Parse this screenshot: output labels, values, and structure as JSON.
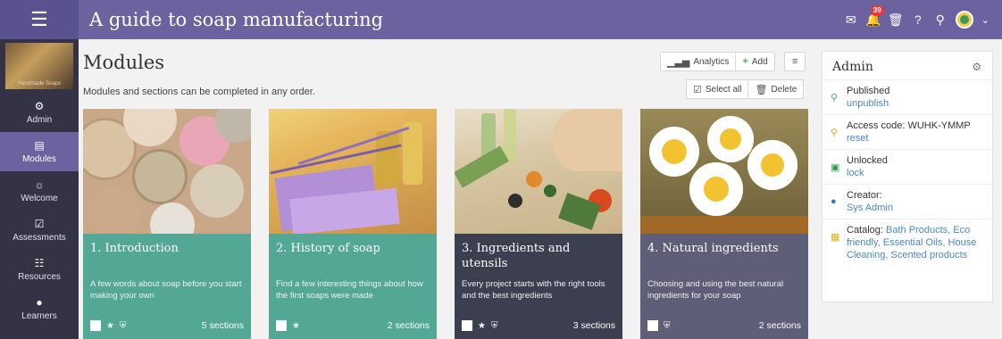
{
  "header": {
    "title": "A guide to soap manufacturing",
    "notification_count": "39"
  },
  "sidebar": {
    "logo_text": "Handmade Soaps",
    "items": [
      {
        "label": "Admin"
      },
      {
        "label": "Modules"
      },
      {
        "label": "Welcome"
      },
      {
        "label": "Assessments"
      },
      {
        "label": "Resources"
      },
      {
        "label": "Learners"
      }
    ]
  },
  "main": {
    "title": "Modules",
    "subtitle": "Modules and sections can be completed in any order.",
    "analytics_label": "Analytics",
    "add_label": "Add",
    "select_all_label": "Select all",
    "delete_label": "Delete"
  },
  "modules": [
    {
      "title": "1. Introduction",
      "desc": "A few words about soap before you start making your own",
      "sections": "5 sections"
    },
    {
      "title": "2. History of soap",
      "desc": "Find a few interesting things about how the first soaps were made",
      "sections": "2 sections"
    },
    {
      "title": "3. Ingredients and utensils",
      "desc": "Every project starts with the right tools and the best ingredients",
      "sections": "3 sections"
    },
    {
      "title": "4. Natural ingredients",
      "desc": "Choosing and using the best natural ingredients for your soap",
      "sections": "2 sections"
    }
  ],
  "admin_panel": {
    "title": "Admin",
    "published_label": "Published",
    "unpublish_link": "unpublish",
    "access_code_label": "Access code: WUHK-YMMP",
    "reset_link": "reset",
    "unlocked_label": "Unlocked",
    "lock_link": "lock",
    "creator_label": "Creator:",
    "creator_name": "Sys Admin",
    "catalog_label": "Catalog:",
    "catalog_items": [
      "Bath Products,",
      "Eco friendly,",
      "Essential Oils,",
      "House Cleaning,",
      "Scented products"
    ]
  },
  "colors": {
    "accent": "#6b629f",
    "sidebar": "#343346",
    "card_teal": "#52a895",
    "card_dark": "#3c3f4f",
    "card_slate": "#5e5e78",
    "link": "#4a87c6"
  }
}
